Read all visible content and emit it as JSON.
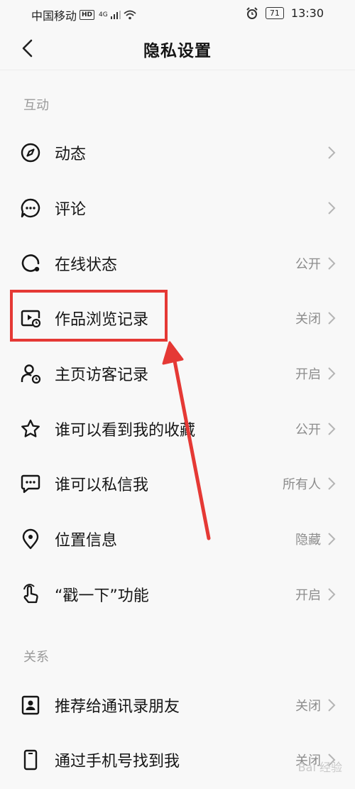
{
  "status_bar": {
    "carrier": "中国移动",
    "hd": "HD",
    "network": "4G",
    "battery": "71",
    "time": "13:30"
  },
  "header": {
    "title": "隐私设置"
  },
  "sections": [
    {
      "title": "互动",
      "items": [
        {
          "label": "动态",
          "value": "",
          "icon": "compass-icon"
        },
        {
          "label": "评论",
          "value": "",
          "icon": "comment-bubble-icon"
        },
        {
          "label": "在线状态",
          "value": "公开",
          "icon": "online-status-icon"
        },
        {
          "label": "作品浏览记录",
          "value": "关闭",
          "icon": "video-history-icon"
        },
        {
          "label": "主页访客记录",
          "value": "开启",
          "icon": "visitor-icon"
        },
        {
          "label": "谁可以看到我的收藏",
          "value": "公开",
          "icon": "star-icon"
        },
        {
          "label": "谁可以私信我",
          "value": "所有人",
          "icon": "message-icon"
        },
        {
          "label": "位置信息",
          "value": "隐藏",
          "icon": "location-pin-icon"
        },
        {
          "label": "“戳一下”功能",
          "value": "开启",
          "icon": "poke-hand-icon"
        }
      ]
    },
    {
      "title": "关系",
      "items": [
        {
          "label": "推荐给通讯录朋友",
          "value": "关闭",
          "icon": "contact-card-icon"
        },
        {
          "label": "通过手机号找到我",
          "value": "关闭",
          "icon": "phone-icon"
        }
      ]
    }
  ],
  "colors": {
    "background": "#f8f8f8",
    "highlight": "#e53935",
    "secondary_text": "#8c8c8c"
  }
}
